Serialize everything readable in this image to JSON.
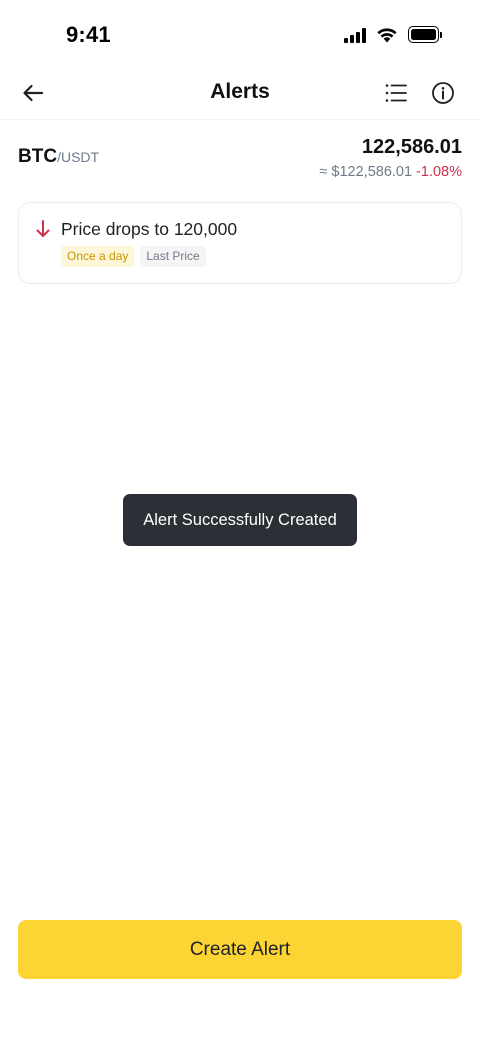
{
  "status_bar": {
    "time": "9:41",
    "icons": [
      "cellular-signal-icon",
      "wifi-icon",
      "battery-icon"
    ]
  },
  "header": {
    "title": "Alerts",
    "icons": [
      "back-arrow-icon",
      "list-icon",
      "info-icon"
    ]
  },
  "pair": {
    "base": "BTC",
    "quote": "/USDT",
    "price": "122,586.01",
    "usd_price": "≈ $122,586.01",
    "change": "-1.08%"
  },
  "alert": {
    "direction_icon": "arrow-down-icon",
    "title": "Price drops to 120,000",
    "frequency": "Once a day",
    "price_type": "Last Price"
  },
  "toast": {
    "message": "Alert Successfully Created"
  },
  "actions": {
    "create_label": "Create Alert"
  },
  "colors": {
    "accent": "#fcd535",
    "negative": "#cf304a",
    "toast_bg": "#2b2f36",
    "tag_freq_bg": "#fdf6d8",
    "tag_freq_text": "#c99400"
  }
}
